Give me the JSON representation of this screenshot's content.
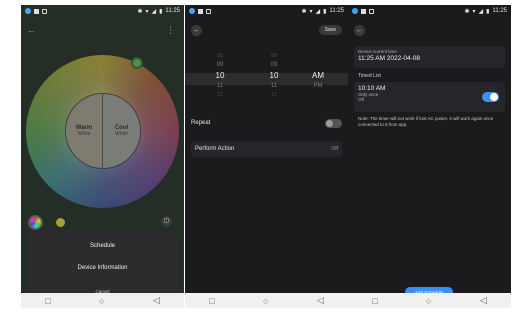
{
  "status_bar": {
    "time": "11:25",
    "battery_label": "▮"
  },
  "nav": {
    "back": "◁",
    "home": "○",
    "recents": "□"
  },
  "phone1": {
    "back_icon": "←",
    "more_icon": "⋮",
    "warm": {
      "title": "Warm",
      "subtitle": "White"
    },
    "cool": {
      "title": "Cool",
      "subtitle": "White"
    },
    "sheet": {
      "schedule": "Schedule",
      "device_information": "Device Information",
      "cancel": "Cancel"
    },
    "colors": {
      "handle": "#4e8c4f",
      "sheet_bg": "#2c2c2e"
    }
  },
  "phone2": {
    "back_icon": "←",
    "save_label": "Save",
    "picker": {
      "hours": [
        "08",
        "09",
        "10",
        "11",
        "12"
      ],
      "minutes": [
        "08",
        "09",
        "10",
        "11",
        "12"
      ],
      "period": [
        "AM",
        "PM"
      ],
      "selected": {
        "hour": "10",
        "minute": "10",
        "period": "AM"
      }
    },
    "repeat_label": "Repeat",
    "repeat_on": false,
    "perform_action_label": "Perform Action",
    "perform_action_value": "Off"
  },
  "phone3": {
    "back_icon": "←",
    "device_time_label": "Device current time",
    "device_time_value": "11:25 AM 2022-04-08",
    "timed_list_label": "Timed List",
    "timer": {
      "time": "10:10 AM",
      "repeat": "Only once",
      "action": "Off",
      "enabled": true
    },
    "note": "Note: The timer will not work if lost AC power, it will work again once connected to it from app.",
    "add_schedule_label": "Add Schedule",
    "colors": {
      "accent": "#3b8ff5"
    }
  }
}
